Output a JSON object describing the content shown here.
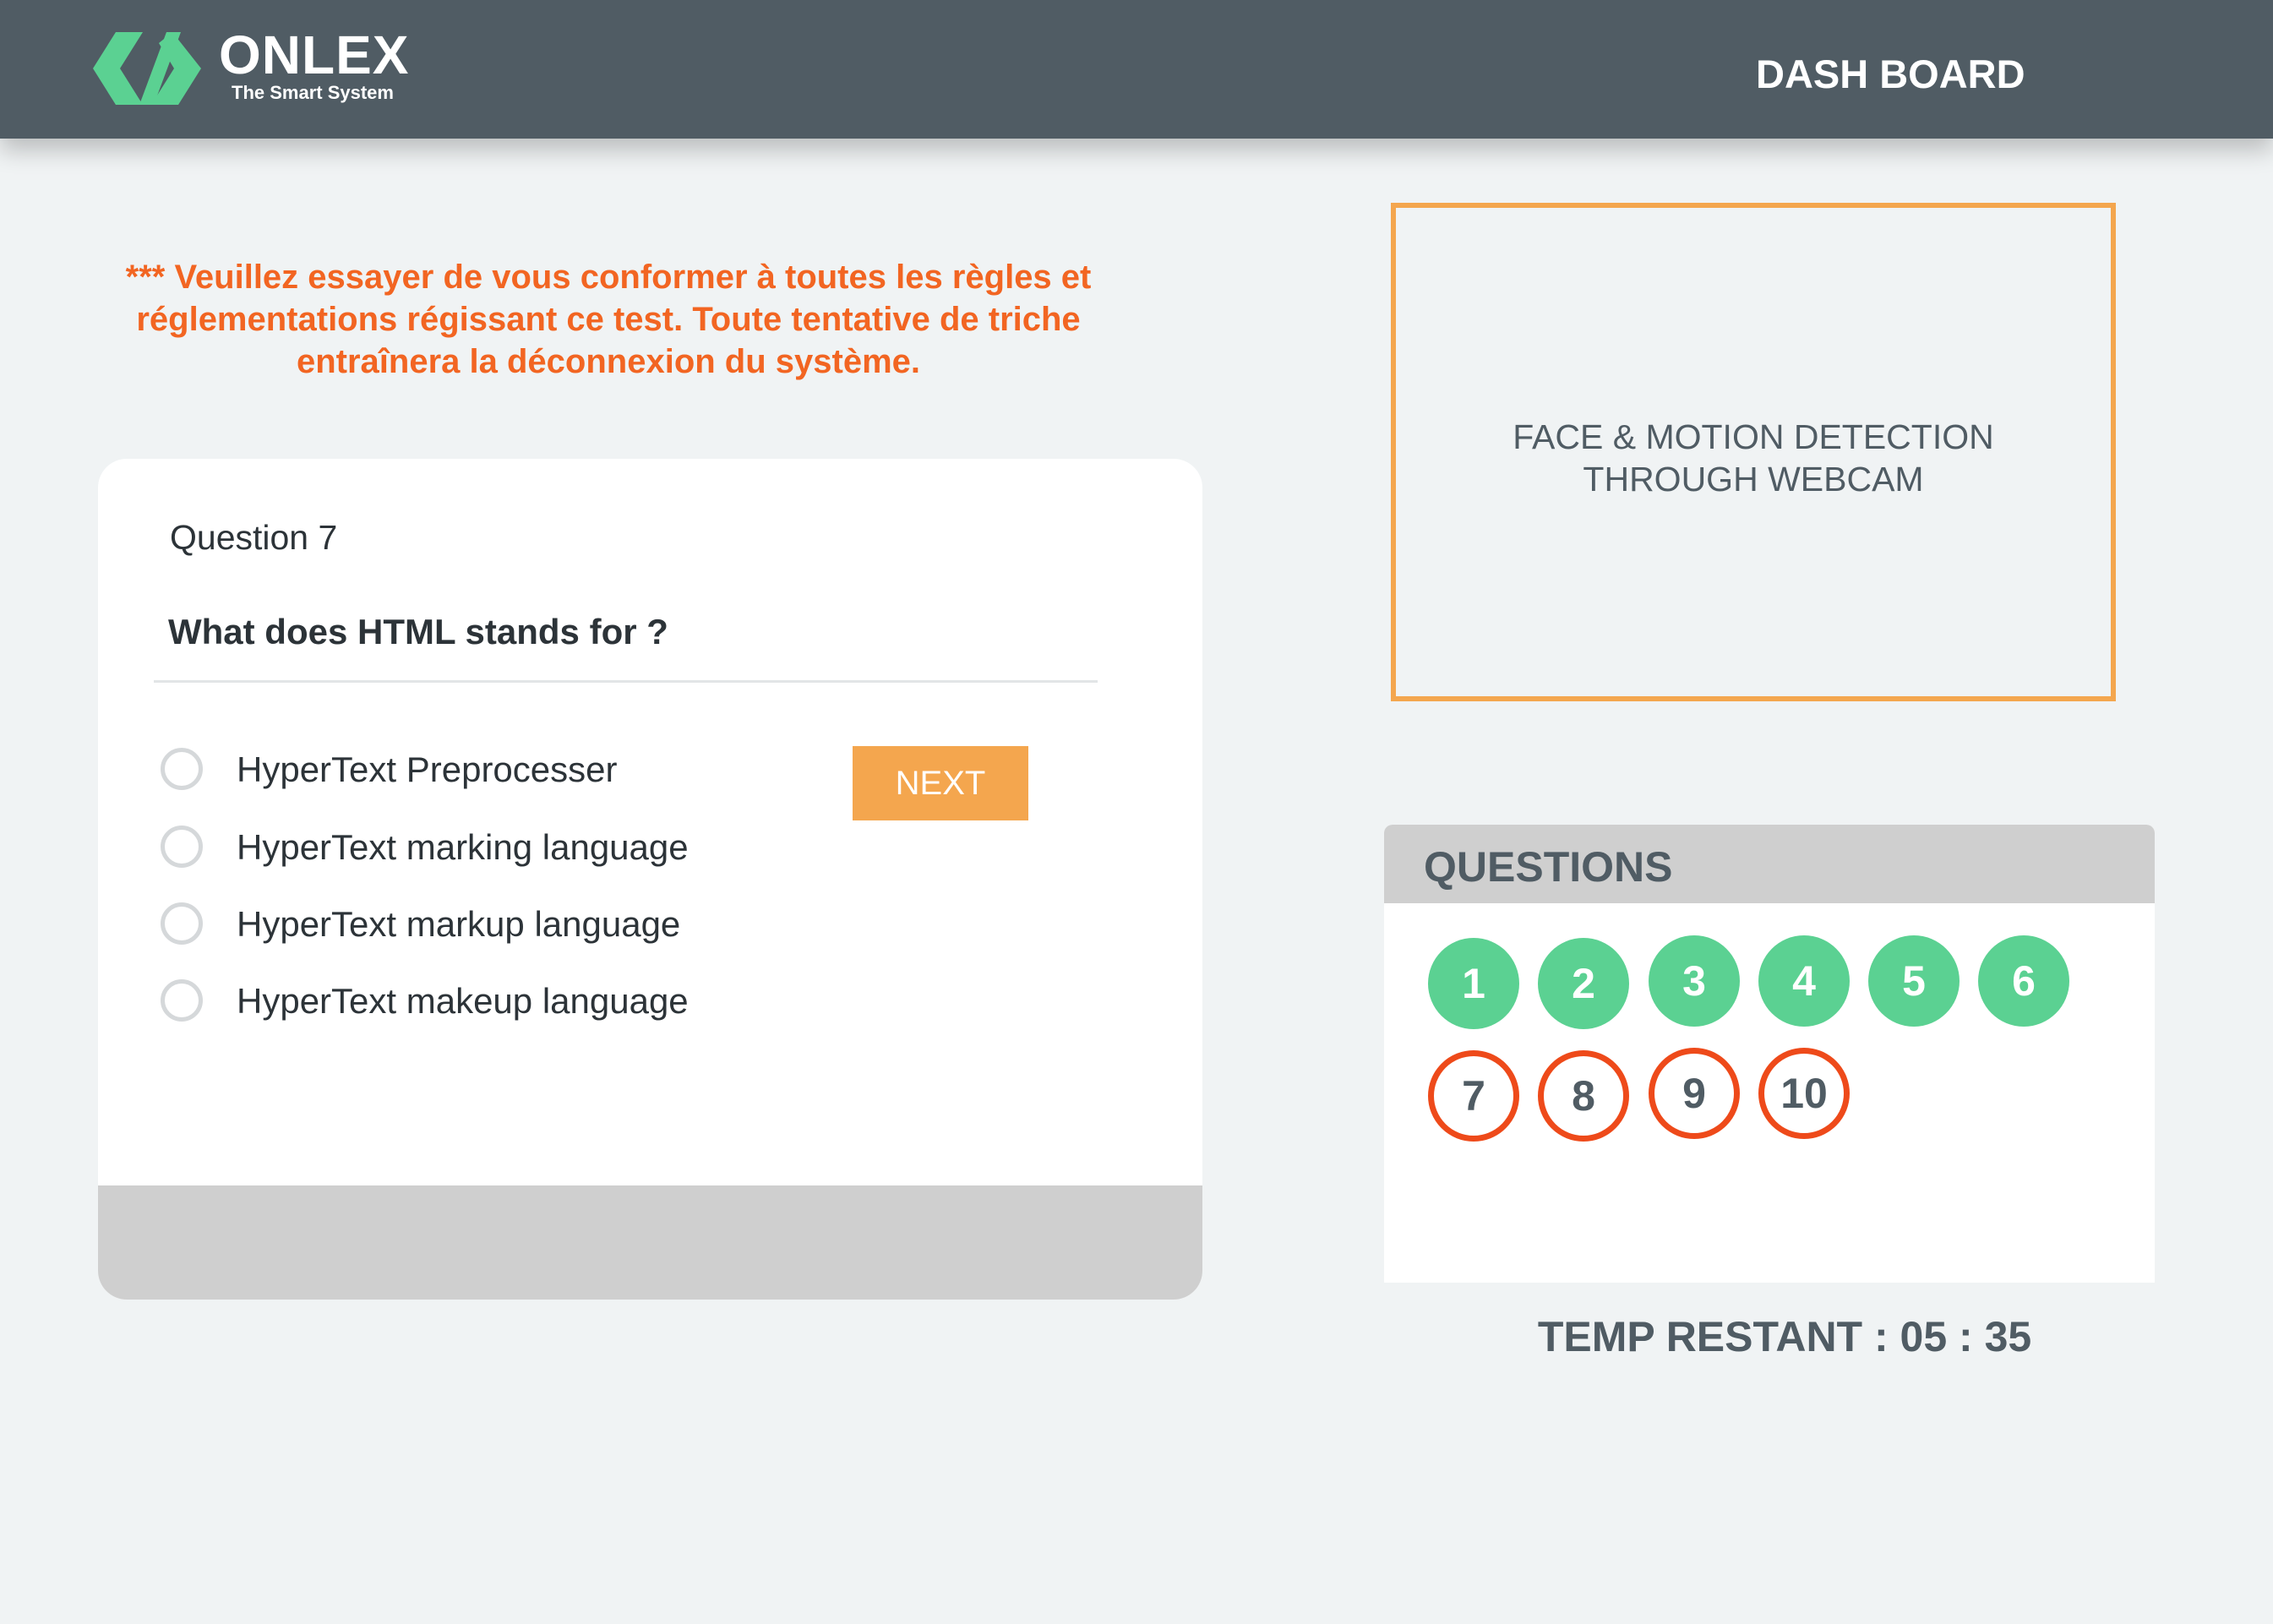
{
  "header": {
    "brand_name": "ONLEX",
    "brand_tagline": "The Smart System",
    "nav_link": "DASH BOARD"
  },
  "warning_text": "*** Veuillez essayer de vous conformer à toutes les règles et réglementations régissant ce test. Toute tentative de triche entraînera la déconnexion du système.",
  "question": {
    "number_label": "Question 7",
    "text": "What does HTML stands for ?",
    "options": [
      "HyperText Preprocesser",
      "HyperText marking language",
      "HyperText markup language",
      "HyperText makeup language"
    ],
    "next_label": "NEXT"
  },
  "webcam": {
    "label_line1": "FACE & MOTION DETECTION",
    "label_line2": "THROUGH WEBCAM"
  },
  "question_panel": {
    "title": "QUESTIONS",
    "items": [
      {
        "label": "1",
        "status": "answered"
      },
      {
        "label": "2",
        "status": "answered"
      },
      {
        "label": "3",
        "status": "answered"
      },
      {
        "label": "4",
        "status": "answered"
      },
      {
        "label": "5",
        "status": "answered"
      },
      {
        "label": "6",
        "status": "answered"
      },
      {
        "label": "7",
        "status": "unanswered"
      },
      {
        "label": "8",
        "status": "unanswered"
      },
      {
        "label": "9",
        "status": "unanswered"
      },
      {
        "label": "10",
        "status": "unanswered"
      }
    ]
  },
  "timer_text": "TEMP RESTANT : 05 : 35",
  "colors": {
    "header_bg": "#505c64",
    "brand_green": "#5bd192",
    "accent_orange": "#f4a64e",
    "warning_orange": "#f26522",
    "unanswered_ring": "#ee4a1a"
  }
}
